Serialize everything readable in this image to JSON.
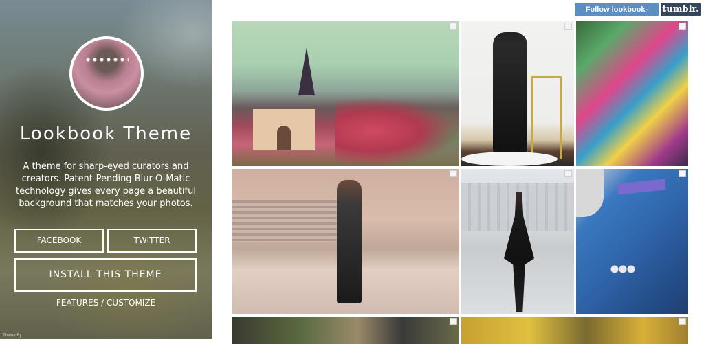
{
  "sidebar": {
    "title": "Lookbook Theme",
    "description": "A theme for sharp-eyed curators and creators. Patent-Pending Blur-O-Matic technology gives every page a beautiful background that matches your photos.",
    "buttons": {
      "facebook": "FACEBOOK",
      "twitter": "TWITTER",
      "install": "INSTALL THIS THEME"
    },
    "features_link": "FEATURES / CUSTOMIZE",
    "theme_by": "Theme By"
  },
  "topbar": {
    "follow_label": "Follow lookbook-theme",
    "tumblr_label": "tumblr."
  },
  "colors": {
    "follow_bg": "#5b8fc4",
    "tumblr_bg": "#36465d"
  },
  "grid": {
    "photos": [
      {
        "subject": "Eiffel Tower and Arc de Triomphe du Carrousel in autumn"
      },
      {
        "subject": "Man in black suit and hat beside gold chair"
      },
      {
        "subject": "Colorful market stall with bags and fabrics"
      },
      {
        "subject": "Woman in leather jacket on stone plaza"
      },
      {
        "subject": "Girl in black dress twirling at the Louvre"
      },
      {
        "subject": "Blue tweed blazer cuff with watch"
      },
      {
        "subject": "Street style crowd"
      },
      {
        "subject": "Autumn trees"
      }
    ]
  }
}
